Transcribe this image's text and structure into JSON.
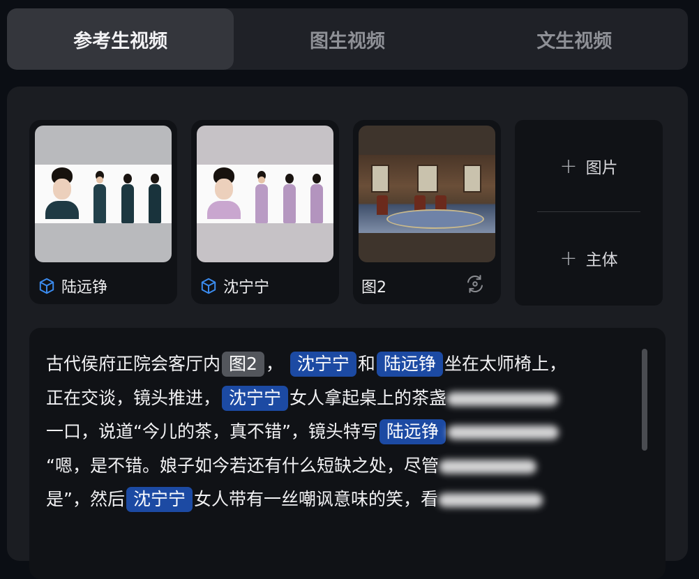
{
  "tabs": [
    {
      "label": "参考生视频",
      "active": true
    },
    {
      "label": "图生视频",
      "active": false
    },
    {
      "label": "文生视频",
      "active": false
    }
  ],
  "cards": [
    {
      "label": "陆远铮",
      "icon": "cube-icon"
    },
    {
      "label": "沈宁宁",
      "icon": "cube-icon"
    },
    {
      "label": "图2",
      "icon": "swap-icon"
    }
  ],
  "add": {
    "image_label": "图片",
    "subject_label": "主体"
  },
  "editor": {
    "line1": {
      "t1": "古代侯府正院会客厅内",
      "tag1": "图2",
      "t2": "，",
      "tag2": "沈宁宁",
      "t3": "和",
      "tag3": "陆远铮",
      "t4": "坐在太师椅上，"
    },
    "line2": {
      "t1": "正在交谈，镜头推进，",
      "tag1": "沈宁宁",
      "t2": "女人拿起桌上的茶盏"
    },
    "line3": {
      "t1": "一口，说道“今儿的茶，真不错”，镜头特写",
      "tag1": "陆远铮"
    },
    "line4": {
      "t1": "“嗯，是不错。娘子如今若还有什么短缺之处，尽管"
    },
    "line5": {
      "t1": "是”，然后",
      "tag1": "沈宁宁",
      "t2": "女人带有一丝嘲讽意味的笑，看"
    }
  },
  "colors": {
    "tag_blue": "#1c4aa3",
    "tag_gray": "#53565c",
    "icon_blue": "#3b8cf0"
  }
}
